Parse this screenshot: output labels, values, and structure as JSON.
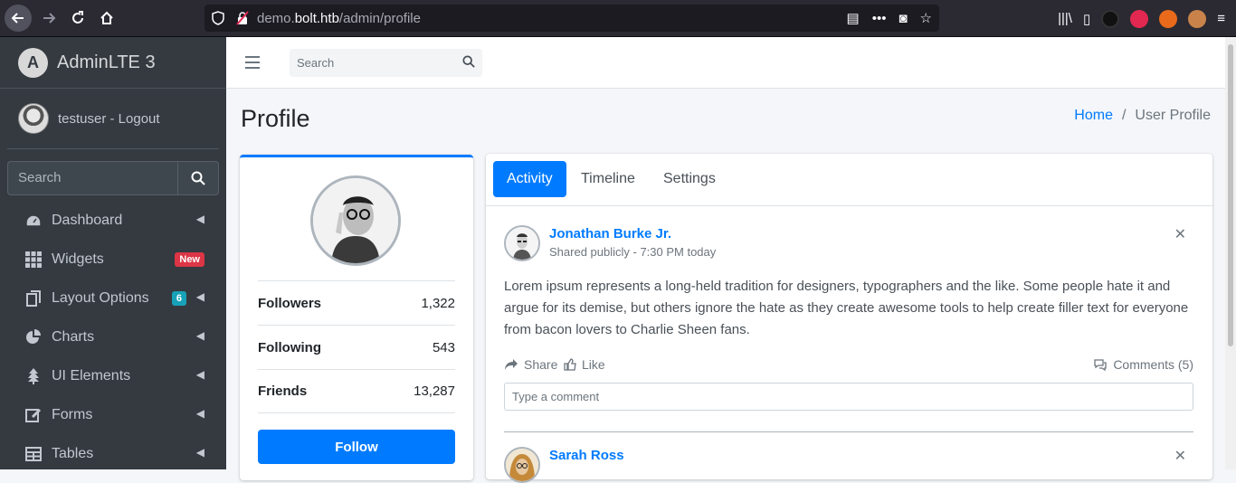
{
  "browser": {
    "url_prefix": "demo.",
    "url_host": "bolt.htb",
    "url_path": "/admin/profile"
  },
  "sidebar": {
    "brand": "AdminLTE 3",
    "user": "testuser - Logout",
    "search_placeholder": "Search",
    "items": [
      {
        "label": "Dashboard",
        "icon": "tachometer-icon"
      },
      {
        "label": "Widgets",
        "icon": "grid-icon",
        "badge": "New"
      },
      {
        "label": "Layout Options",
        "icon": "copy-icon",
        "badge": "6"
      },
      {
        "label": "Charts",
        "icon": "pie-chart-icon"
      },
      {
        "label": "UI Elements",
        "icon": "tree-icon"
      },
      {
        "label": "Forms",
        "icon": "edit-icon"
      },
      {
        "label": "Tables",
        "icon": "table-icon"
      }
    ]
  },
  "topnav": {
    "search_placeholder": "Search"
  },
  "page": {
    "title": "Profile",
    "breadcrumb_home": "Home",
    "breadcrumb_current": "User Profile"
  },
  "profile": {
    "stats": [
      {
        "label": "Followers",
        "value": "1,322"
      },
      {
        "label": "Following",
        "value": "543"
      },
      {
        "label": "Friends",
        "value": "13,287"
      }
    ],
    "follow_label": "Follow"
  },
  "activity": {
    "tabs": [
      "Activity",
      "Timeline",
      "Settings"
    ],
    "posts": [
      {
        "user": "Jonathan Burke Jr.",
        "description": "Shared publicly - 7:30 PM today",
        "text": "Lorem ipsum represents a long-held tradition for designers, typographers and the like. Some people hate it and argue for its demise, but others ignore the hate as they create awesome tools to help create filler text for everyone from bacon lovers to Charlie Sheen fans.",
        "share": "Share",
        "like": "Like",
        "comments": "Comments (5)",
        "comment_placeholder": "Type a comment"
      },
      {
        "user": "Sarah Ross"
      }
    ]
  },
  "colors": {
    "primary": "#007bff",
    "sidebar_bg": "#343a40",
    "badge_new": "#dc3545",
    "badge_info": "#17a2b8"
  }
}
